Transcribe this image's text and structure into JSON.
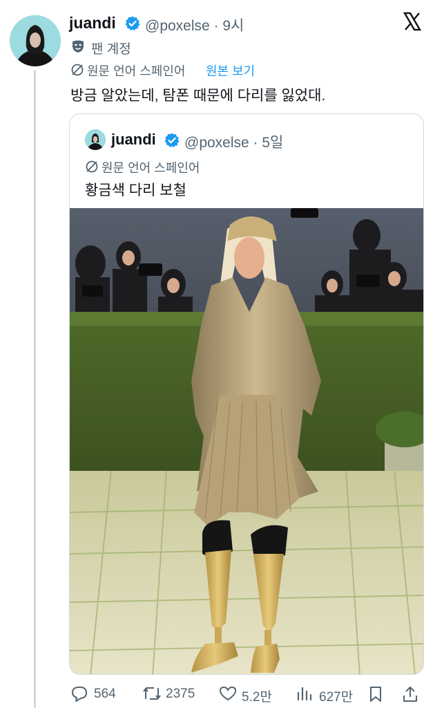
{
  "tweet": {
    "author_name": "juandi",
    "handle_time": "@poxelse · 9시",
    "fan_label": "팬 계정",
    "original_language_label": "원문 언어 스페인어",
    "show_original_link": "원본 보기",
    "text": "방금 알았는데, 탐폰 때문에 다리를 잃었대."
  },
  "quote": {
    "author_name": "juandi",
    "handle_time": "@poxelse · 5일",
    "original_language_label": "원문 언어 스페인어",
    "text": "황금색 다리 보철"
  },
  "actions": {
    "replies": "564",
    "retweets": "2375",
    "likes": "5.2만",
    "views": "627만"
  },
  "colors": {
    "verified": "#1d9bf0",
    "link": "#1d9bf0",
    "secondary_text": "#536471",
    "border": "#cfd9de"
  },
  "icons": [
    "x-logo-icon",
    "verified-badge-icon",
    "fan-mask-icon",
    "translate-globe-icon",
    "reply-icon",
    "retweet-icon",
    "like-icon",
    "views-icon",
    "bookmark-icon",
    "share-icon"
  ]
}
